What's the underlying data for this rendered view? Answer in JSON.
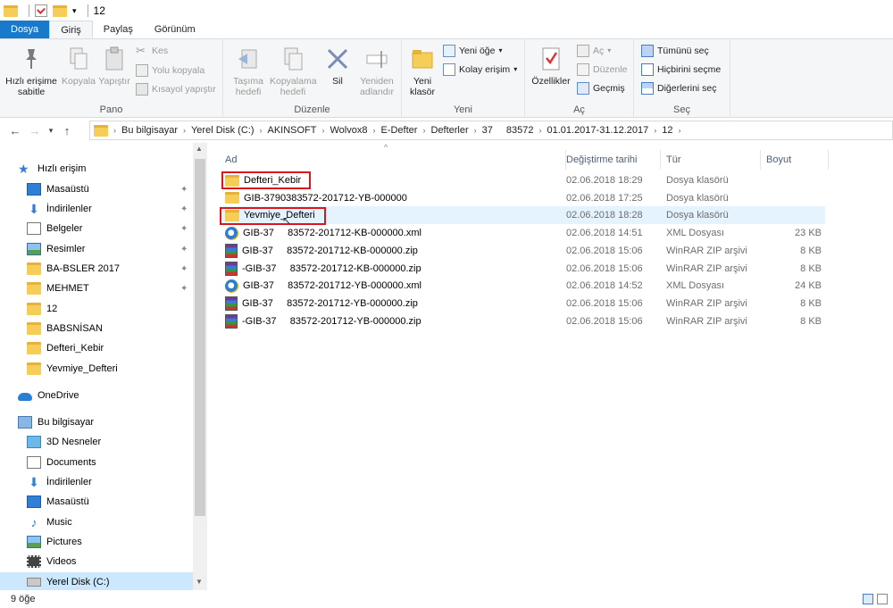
{
  "window": {
    "title": "12"
  },
  "ribbon_tabs": [
    "Dosya",
    "Giriş",
    "Paylaş",
    "Görünüm"
  ],
  "ribbon": {
    "pano": {
      "label": "Pano",
      "pin": "Hızlı erişime sabitle",
      "copy": "Kopyala",
      "paste": "Yapıştır",
      "cut": "Kes",
      "copy_path": "Yolu kopyala",
      "paste_shortcut": "Kısayol yapıştır"
    },
    "duzenle": {
      "label": "Düzenle",
      "move_to": "Taşıma hedefi",
      "copy_to": "Kopyalama hedefi",
      "delete": "Sil",
      "rename": "Yeniden adlandır"
    },
    "yeni": {
      "label": "Yeni",
      "new_folder": "Yeni klasör",
      "new_item": "Yeni öğe",
      "easy_access": "Kolay erişim"
    },
    "ac": {
      "label": "Aç",
      "properties": "Özellikler",
      "open": "Aç",
      "edit": "Düzenle",
      "history": "Geçmiş"
    },
    "sec": {
      "label": "Seç",
      "select_all": "Tümünü seç",
      "select_none": "Hiçbirini seçme",
      "invert": "Diğerlerini seç"
    }
  },
  "address": {
    "crumbs": [
      "Bu bilgisayar",
      "Yerel Disk (C:)",
      "AKINSOFT",
      "Wolvox8",
      "E-Defter",
      "Defterler",
      "37",
      "83572",
      "01.01.2017-31.12.2017",
      "12"
    ]
  },
  "nav": {
    "quick_access": "Hızlı erişim",
    "quick_items": [
      "Masaüstü",
      "İndirilenler",
      "Belgeler",
      "Resimler",
      "BA-BSLER 2017",
      "MEHMET",
      "12",
      "BABSNİSAN",
      "Defteri_Kebir",
      "Yevmiye_Defteri"
    ],
    "onedrive": "OneDrive",
    "this_pc": "Bu bilgisayar",
    "pc_items": [
      "3D Nesneler",
      "Documents",
      "İndirilenler",
      "Masaüstü",
      "Music",
      "Pictures",
      "Videos",
      "Yerel Disk (C:)"
    ]
  },
  "columns": {
    "name": "Ad",
    "date": "Değiştirme tarihi",
    "type": "Tür",
    "size": "Boyut"
  },
  "files": [
    {
      "name": "Defteri_Kebir",
      "date": "02.06.2018 18:29",
      "type": "Dosya klasörü",
      "size": "",
      "icon": "folder-icon"
    },
    {
      "name": "GIB-3790383572-201712-YB-000000",
      "date": "02.06.2018 17:25",
      "type": "Dosya klasörü",
      "size": "",
      "icon": "folder-icon"
    },
    {
      "name": "Yevmiye_Defteri",
      "date": "02.06.2018 18:28",
      "type": "Dosya klasörü",
      "size": "",
      "icon": "folder-icon"
    },
    {
      "name": "GIB-37     83572-201712-KB-000000.xml",
      "date": "02.06.2018 14:51",
      "type": "XML Dosyası",
      "size": "23 KB",
      "icon": "xml-icon"
    },
    {
      "name": "GIB-37     83572-201712-KB-000000.zip",
      "date": "02.06.2018 15:06",
      "type": "WinRAR ZIP arşivi",
      "size": "8 KB",
      "icon": "winrar-icon"
    },
    {
      "name": "-GIB-37     83572-201712-KB-000000.zip",
      "date": "02.06.2018 15:06",
      "type": "WinRAR ZIP arşivi",
      "size": "8 KB",
      "icon": "winrar-icon"
    },
    {
      "name": "GIB-37     83572-201712-YB-000000.xml",
      "date": "02.06.2018 14:52",
      "type": "XML Dosyası",
      "size": "24 KB",
      "icon": "xml-icon"
    },
    {
      "name": "GIB-37     83572-201712-YB-000000.zip",
      "date": "02.06.2018 15:06",
      "type": "WinRAR ZIP arşivi",
      "size": "8 KB",
      "icon": "winrar-icon"
    },
    {
      "name": "-GIB-37     83572-201712-YB-000000.zip",
      "date": "02.06.2018 15:06",
      "type": "WinRAR ZIP arşivi",
      "size": "8 KB",
      "icon": "winrar-icon"
    }
  ],
  "status": {
    "count": "9 öğe"
  },
  "colors": {
    "accent": "#1979ca",
    "highlight_box": "#d8161d",
    "folder": "#f5cd57",
    "hover_row": "#e5f3ff"
  }
}
